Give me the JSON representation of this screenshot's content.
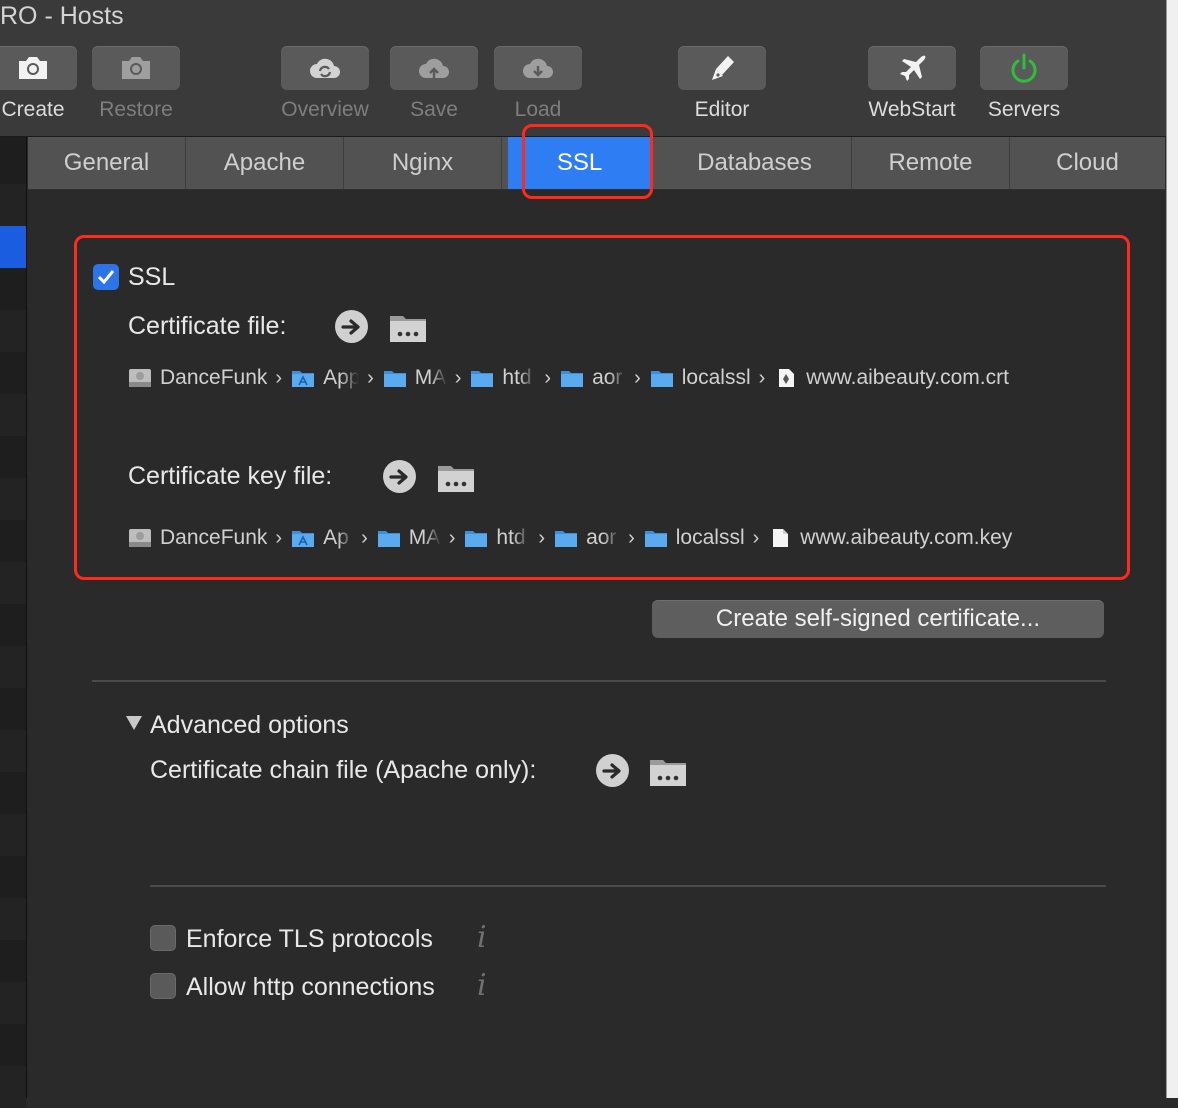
{
  "window": {
    "title": "RO - Hosts"
  },
  "toolbar": {
    "items": [
      {
        "label": "Create",
        "icon": "camera-icon",
        "enabled": true
      },
      {
        "label": "Restore",
        "icon": "camera-icon",
        "enabled": false
      },
      {
        "label": "Overview",
        "icon": "cloud-sync-icon",
        "enabled": false
      },
      {
        "label": "Save",
        "icon": "cloud-upload-icon",
        "enabled": false
      },
      {
        "label": "Load",
        "icon": "cloud-download-icon",
        "enabled": false
      },
      {
        "label": "Editor",
        "icon": "pen-nib-icon",
        "enabled": true
      },
      {
        "label": "WebStart",
        "icon": "airplane-icon",
        "enabled": true
      },
      {
        "label": "Servers",
        "icon": "power-icon",
        "enabled": true
      }
    ]
  },
  "tabs": [
    {
      "label": "General"
    },
    {
      "label": "Apache"
    },
    {
      "label": "Nginx"
    },
    {
      "label": "SSL",
      "active": true
    },
    {
      "label": "Databases"
    },
    {
      "label": "Remote"
    },
    {
      "label": "Cloud"
    }
  ],
  "ssl": {
    "enabled_label": "SSL",
    "enabled": true,
    "cert_label": "Certificate file:",
    "cert_path": [
      "DanceFunk",
      "App",
      "MA",
      "htd",
      "aor",
      "localssl",
      "www.aibeauty.com.crt"
    ],
    "key_label": "Certificate key file:",
    "key_path": [
      "DanceFunk",
      "Ap",
      "MA",
      "htd",
      "aor",
      "localssl",
      "www.aibeauty.com.key"
    ],
    "create_cert_button": "Create self-signed certificate..."
  },
  "advanced": {
    "title": "Advanced options",
    "chain_label": "Certificate chain file (Apache only):",
    "enforce_tls_label": "Enforce TLS protocols",
    "enforce_tls": false,
    "allow_http_label": "Allow http connections",
    "allow_http": false,
    "info_glyph": "i"
  },
  "colors": {
    "accent": "#2f7df3",
    "annotation": "#ff2a1e",
    "servers_power": "#2fbf3a"
  }
}
